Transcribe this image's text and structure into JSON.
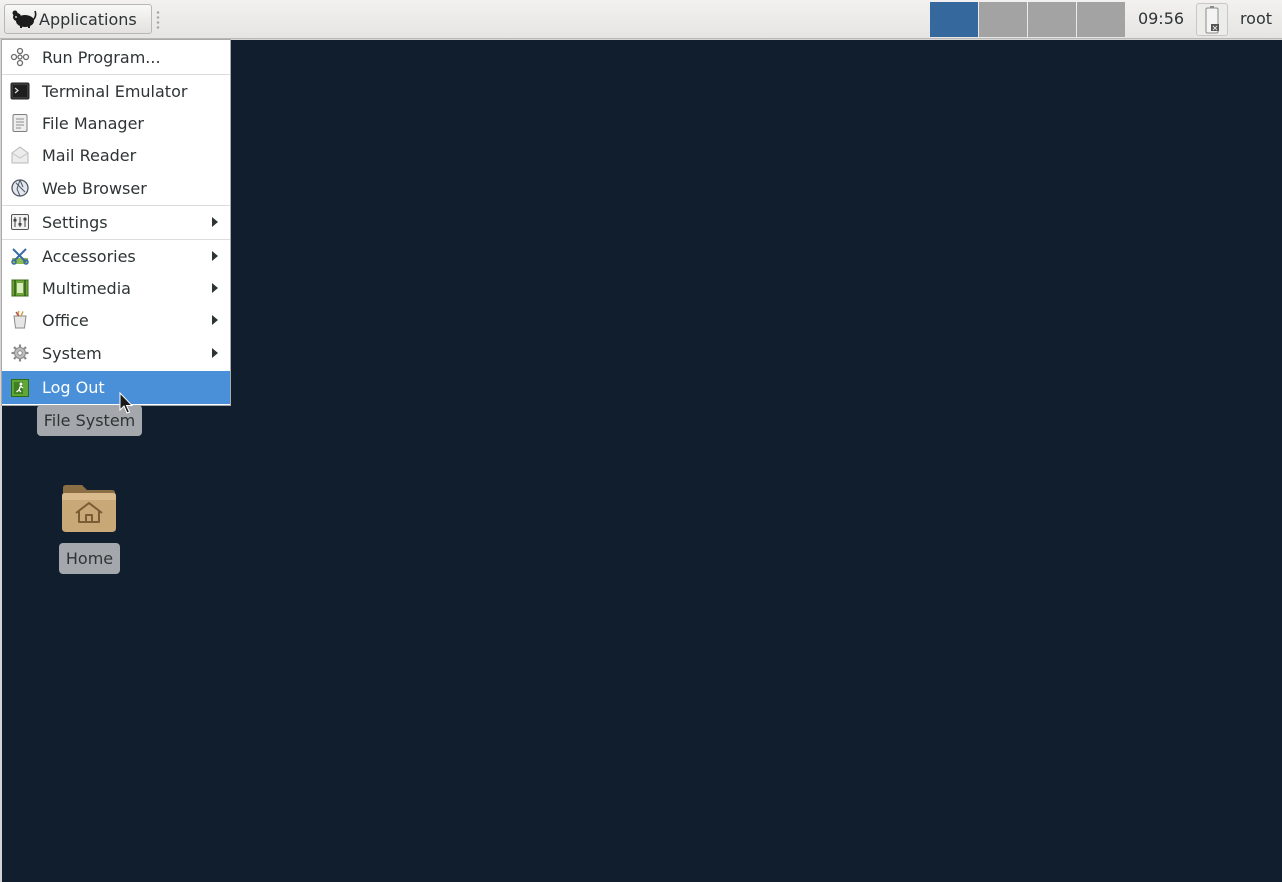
{
  "panel": {
    "app_button_label": "Applications",
    "clock": "09:56",
    "user": "root",
    "workspace_count": 4,
    "active_workspace": 1
  },
  "menu": {
    "items": [
      {
        "label": "Run Program...",
        "icon": "run-program-icon"
      },
      {
        "label": "Terminal Emulator",
        "icon": "terminal-icon"
      },
      {
        "label": "File Manager",
        "icon": "file-manager-icon"
      },
      {
        "label": "Mail Reader",
        "icon": "mail-reader-icon"
      },
      {
        "label": "Web Browser",
        "icon": "web-browser-icon"
      },
      {
        "label": "Settings",
        "icon": "settings-icon",
        "submenu": true
      },
      {
        "label": "Accessories",
        "icon": "accessories-icon",
        "submenu": true
      },
      {
        "label": "Multimedia",
        "icon": "multimedia-icon",
        "submenu": true
      },
      {
        "label": "Office",
        "icon": "office-icon",
        "submenu": true
      },
      {
        "label": "System",
        "icon": "system-icon",
        "submenu": true
      },
      {
        "label": "Log Out",
        "icon": "log-out-icon",
        "highlighted": true
      }
    ]
  },
  "desktop": {
    "icons": [
      {
        "label": "File System",
        "icon": "file-system-icon"
      },
      {
        "label": "Home",
        "icon": "home-folder-icon"
      }
    ]
  },
  "colors": {
    "desktop_bg": "#111e2e",
    "highlight": "#4a90d9",
    "active_workspace": "#35699d"
  }
}
